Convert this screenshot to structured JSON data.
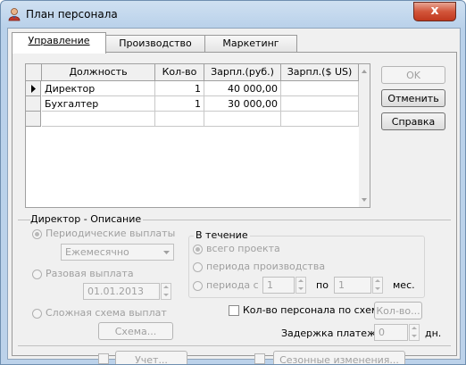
{
  "window": {
    "title": "План персонала",
    "close_label": "x"
  },
  "tabs": [
    {
      "label": "Управление",
      "active": true
    },
    {
      "label": "Производство",
      "active": false
    },
    {
      "label": "Маркетинг",
      "active": false
    }
  ],
  "grid": {
    "columns": [
      "Должность",
      "Кол-во",
      "Зарпл.(руб.)",
      "Зарпл.($ US)"
    ],
    "rows": [
      {
        "position": "Директор",
        "count": "1",
        "salary_rub": "40 000,00",
        "salary_usd": "",
        "current": true
      },
      {
        "position": "Бухгалтер",
        "count": "1",
        "salary_rub": "30 000,00",
        "salary_usd": "",
        "current": false
      }
    ]
  },
  "buttons": {
    "ok": "OK",
    "cancel": "Отменить",
    "help": "Справка"
  },
  "description": {
    "title": "Директор  - Описание",
    "periodic": "Периодические выплаты",
    "frequency": "Ежемесячно",
    "one_time": "Разовая выплата",
    "date": "01.01.2013",
    "complex": "Сложная схема выплат",
    "scheme_button": "Схема...",
    "during_title": "В течение",
    "whole_project": "всего проекта",
    "production_period": "периода производства",
    "period_from": "периода с",
    "period_from_value": "1",
    "period_to_label": "по",
    "period_to_value": "1",
    "months_label": "мес.",
    "headcount_by_scheme": "Кол-во персонала по схеме",
    "count_button": "Кол-во...",
    "payment_delay": "Задержка платежей:",
    "payment_delay_value": "0",
    "days_label": "дн.",
    "accounting_button": "Учет...",
    "seasonal_button": "Сезонные изменения..."
  }
}
